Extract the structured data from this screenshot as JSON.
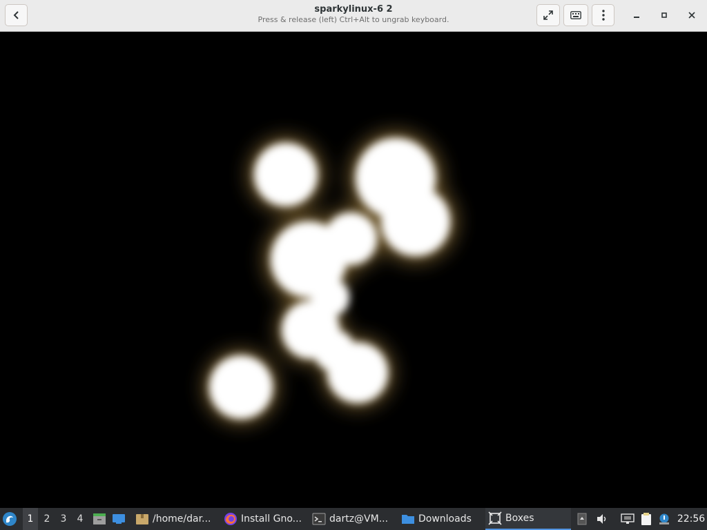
{
  "window": {
    "title": "sparkylinux-6 2",
    "subtitle": "Press & release (left) Ctrl+Alt to ungrab keyboard.",
    "icons": {
      "back": "back-arrow-icon",
      "fullscreen": "fullscreen-icon",
      "keyboard": "keyboard-icon",
      "menu": "kebab-menu-icon",
      "minimize": "minimize-icon",
      "maximize": "maximize-icon",
      "close": "close-icon"
    }
  },
  "guest_display": {
    "content": "boot-splash-blobs",
    "blob_color": "#ffffff",
    "glow_color": "#8a6d35"
  },
  "taskbar": {
    "workspaces": [
      "1",
      "2",
      "3",
      "4"
    ],
    "active_workspace": "1",
    "tasks": [
      {
        "label": "/home/dar...",
        "icon": "folder-icon"
      },
      {
        "label": "Install Gno...",
        "icon": "firefox-icon"
      },
      {
        "label": "dartz@VM...",
        "icon": "terminal-icon"
      },
      {
        "label": "Downloads",
        "icon": "folder-blue-icon"
      },
      {
        "label": "Boxes",
        "icon": "boxes-icon",
        "active": true
      }
    ],
    "clock": "22:56",
    "accent_color": "#5294e2"
  }
}
